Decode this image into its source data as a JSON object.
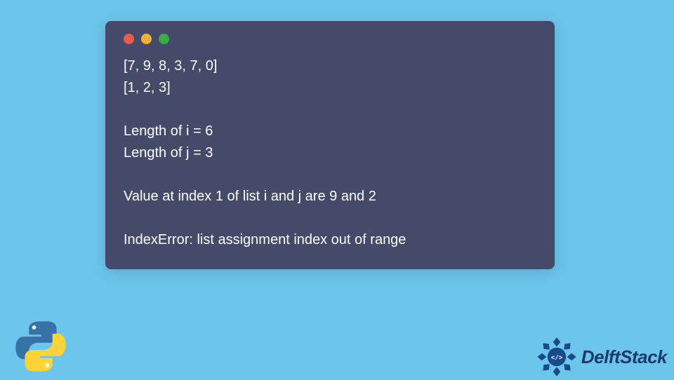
{
  "window": {
    "dots": [
      "red",
      "yellow",
      "green"
    ],
    "lines": [
      "[7, 9, 8, 3, 7, 0]",
      "[1, 2, 3]",
      "",
      "Length of i = 6",
      "Length of j = 3",
      "",
      "Value at index 1 of list i and j are 9 and 2",
      "",
      "IndexError: list assignment index out of range"
    ]
  },
  "branding": {
    "site_name": "DelftStack"
  }
}
